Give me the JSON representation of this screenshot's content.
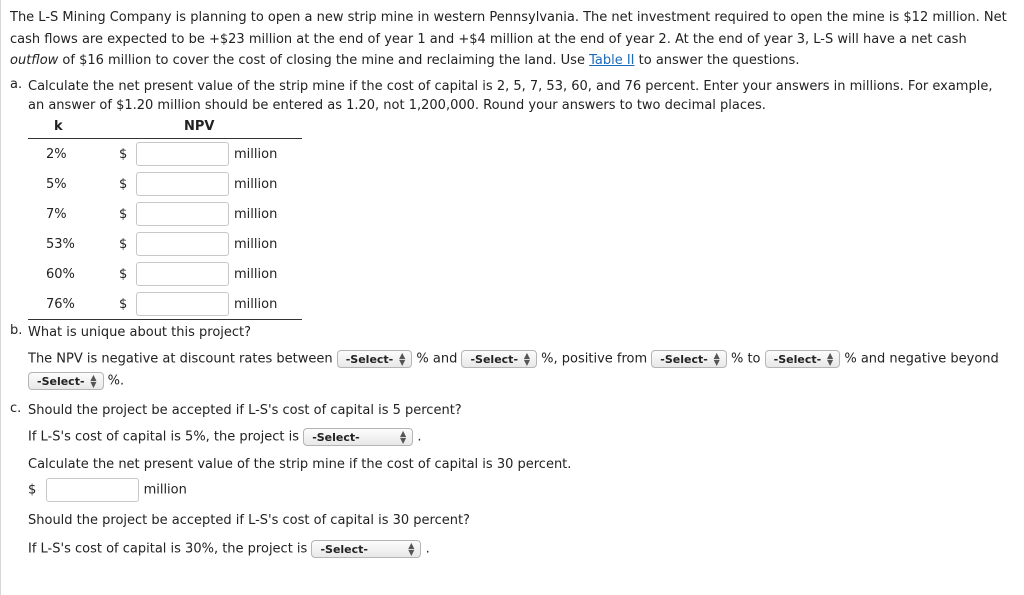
{
  "intro": {
    "text_before_italic": "The L-S Mining Company is planning to open a new strip mine in western Pennsylvania. The net investment required to open the mine is $12 million. Net cash flows are expected to be +$23 million at the end of year 1 and +$4 million at the end of year 2. At the end of year 3, L-S will have a net cash ",
    "italic": "outflow",
    "text_after_italic": " of $16 million to cover the cost of closing the mine and reclaiming the land. Use ",
    "link": "Table II",
    "text_end": " to answer the questions."
  },
  "part_a": {
    "letter": "a.",
    "question": "Calculate the net present value of the strip mine if the cost of capital is 2, 5, 7, 53, 60, and 76 percent. Enter your answers in millions. For example, an answer of $1.20 million should be entered as 1.20, not 1,200,000. Round your answers to two decimal places.",
    "col_k": "k",
    "col_npv": "NPV",
    "rows": [
      {
        "rate": "2%",
        "currency": "$",
        "value": "",
        "unit": "million"
      },
      {
        "rate": "5%",
        "currency": "$",
        "value": "",
        "unit": "million"
      },
      {
        "rate": "7%",
        "currency": "$",
        "value": "",
        "unit": "million"
      },
      {
        "rate": "53%",
        "currency": "$",
        "value": "",
        "unit": "million"
      },
      {
        "rate": "60%",
        "currency": "$",
        "value": "",
        "unit": "million"
      },
      {
        "rate": "76%",
        "currency": "$",
        "value": "",
        "unit": "million"
      }
    ]
  },
  "part_b": {
    "letter": "b.",
    "question": "What is unique about this project?",
    "s1": "The NPV is negative at discount rates between",
    "s2": "% and",
    "s3": "%, positive from",
    "s4": "% to",
    "s5": "% and negative beyond",
    "s6": "%.",
    "select_label": "-Select-"
  },
  "part_c": {
    "letter": "c.",
    "question": "Should the project be accepted if L-S's cost of capital is 5 percent?",
    "line5": "If L-S's cost of capital is 5%, the project is",
    "calc30": "Calculate the net present value of the strip mine if the cost of capital is 30 percent.",
    "currency": "$",
    "value30": "",
    "unit": "million",
    "question30": "Should the project be accepted if L-S's cost of capital is 30 percent?",
    "line30": "If L-S's cost of capital is 30%, the project is",
    "select_label": "-Select-",
    "period": "."
  }
}
